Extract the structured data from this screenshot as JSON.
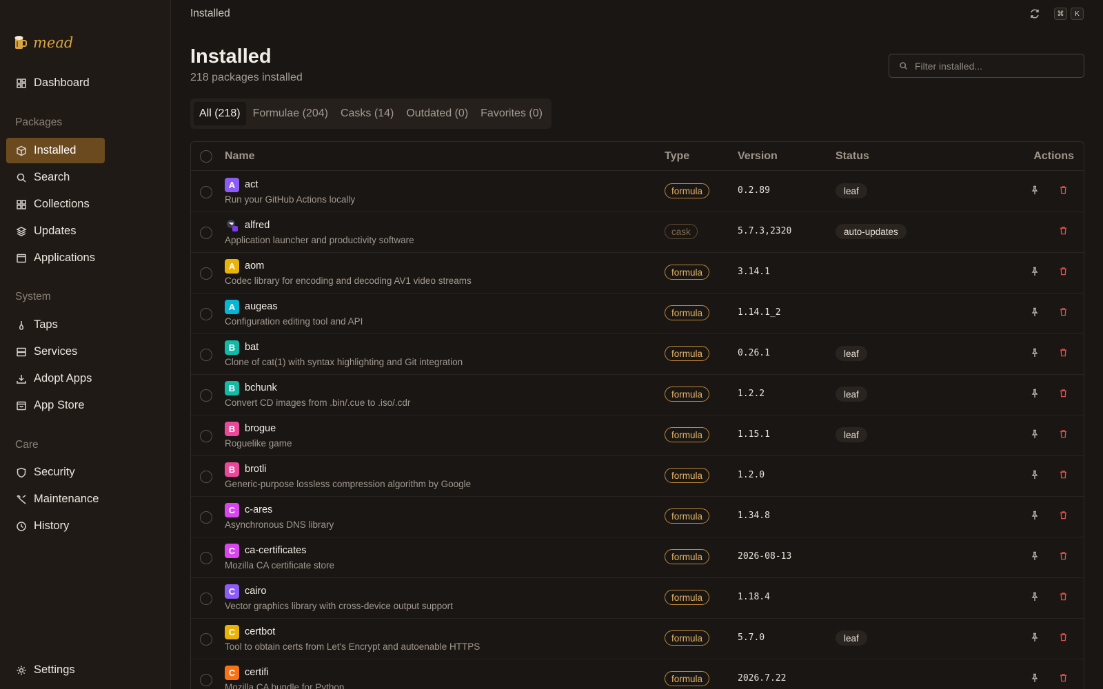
{
  "app": {
    "name": "mead"
  },
  "topbar": {
    "title": "Installed",
    "kbd_cmd": "⌘",
    "kbd_k": "K"
  },
  "sidebar": {
    "dashboard": "Dashboard",
    "sections": {
      "packages": "Packages",
      "system": "System",
      "care": "Care"
    },
    "packages": [
      "Installed",
      "Search",
      "Collections",
      "Updates",
      "Applications"
    ],
    "system": [
      "Taps",
      "Services",
      "Adopt Apps",
      "App Store"
    ],
    "care": [
      "Security",
      "Maintenance",
      "History"
    ],
    "settings": "Settings"
  },
  "header": {
    "title": "Installed",
    "subtitle": "218 packages installed",
    "filter_placeholder": "Filter installed..."
  },
  "tabs": [
    "All (218)",
    "Formulae (204)",
    "Casks (14)",
    "Outdated (0)",
    "Favorites (0)"
  ],
  "table": {
    "columns": {
      "name": "Name",
      "type": "Type",
      "version": "Version",
      "status": "Status",
      "actions": "Actions"
    },
    "rows": [
      {
        "letter": "A",
        "color": "#8b5cf6",
        "name": "act",
        "desc": "Run your GitHub Actions locally",
        "type": "formula",
        "version": "0.2.89",
        "status": "leaf",
        "pin": true
      },
      {
        "letter": "",
        "color": "",
        "name": "alfred",
        "desc": "Application launcher and productivity software",
        "type": "cask",
        "version": "5.7.3,2320",
        "status": "auto-updates",
        "pin": false
      },
      {
        "letter": "A",
        "color": "#eab308",
        "name": "aom",
        "desc": "Codec library for encoding and decoding AV1 video streams",
        "type": "formula",
        "version": "3.14.1",
        "status": "",
        "pin": true
      },
      {
        "letter": "A",
        "color": "#06b6d4",
        "name": "augeas",
        "desc": "Configuration editing tool and API",
        "type": "formula",
        "version": "1.14.1_2",
        "status": "",
        "pin": true
      },
      {
        "letter": "B",
        "color": "#14b8a6",
        "name": "bat",
        "desc": "Clone of cat(1) with syntax highlighting and Git integration",
        "type": "formula",
        "version": "0.26.1",
        "status": "leaf",
        "pin": true
      },
      {
        "letter": "B",
        "color": "#14b8a6",
        "name": "bchunk",
        "desc": "Convert CD images from .bin/.cue to .iso/.cdr",
        "type": "formula",
        "version": "1.2.2",
        "status": "leaf",
        "pin": true
      },
      {
        "letter": "B",
        "color": "#ec4899",
        "name": "brogue",
        "desc": "Roguelike game",
        "type": "formula",
        "version": "1.15.1",
        "status": "leaf",
        "pin": true
      },
      {
        "letter": "B",
        "color": "#ec4899",
        "name": "brotli",
        "desc": "Generic-purpose lossless compression algorithm by Google",
        "type": "formula",
        "version": "1.2.0",
        "status": "",
        "pin": true
      },
      {
        "letter": "C",
        "color": "#d946ef",
        "name": "c-ares",
        "desc": "Asynchronous DNS library",
        "type": "formula",
        "version": "1.34.8",
        "status": "",
        "pin": true
      },
      {
        "letter": "C",
        "color": "#d946ef",
        "name": "ca-certificates",
        "desc": "Mozilla CA certificate store",
        "type": "formula",
        "version": "2026-08-13",
        "status": "",
        "pin": true
      },
      {
        "letter": "C",
        "color": "#8b5cf6",
        "name": "cairo",
        "desc": "Vector graphics library with cross-device output support",
        "type": "formula",
        "version": "1.18.4",
        "status": "",
        "pin": true
      },
      {
        "letter": "C",
        "color": "#eab308",
        "name": "certbot",
        "desc": "Tool to obtain certs from Let's Encrypt and autoenable HTTPS",
        "type": "formula",
        "version": "5.7.0",
        "status": "leaf",
        "pin": true
      },
      {
        "letter": "C",
        "color": "#f97316",
        "name": "certifi",
        "desc": "Mozilla CA bundle for Python",
        "type": "formula",
        "version": "2026.7.22",
        "status": "",
        "pin": true
      }
    ]
  }
}
